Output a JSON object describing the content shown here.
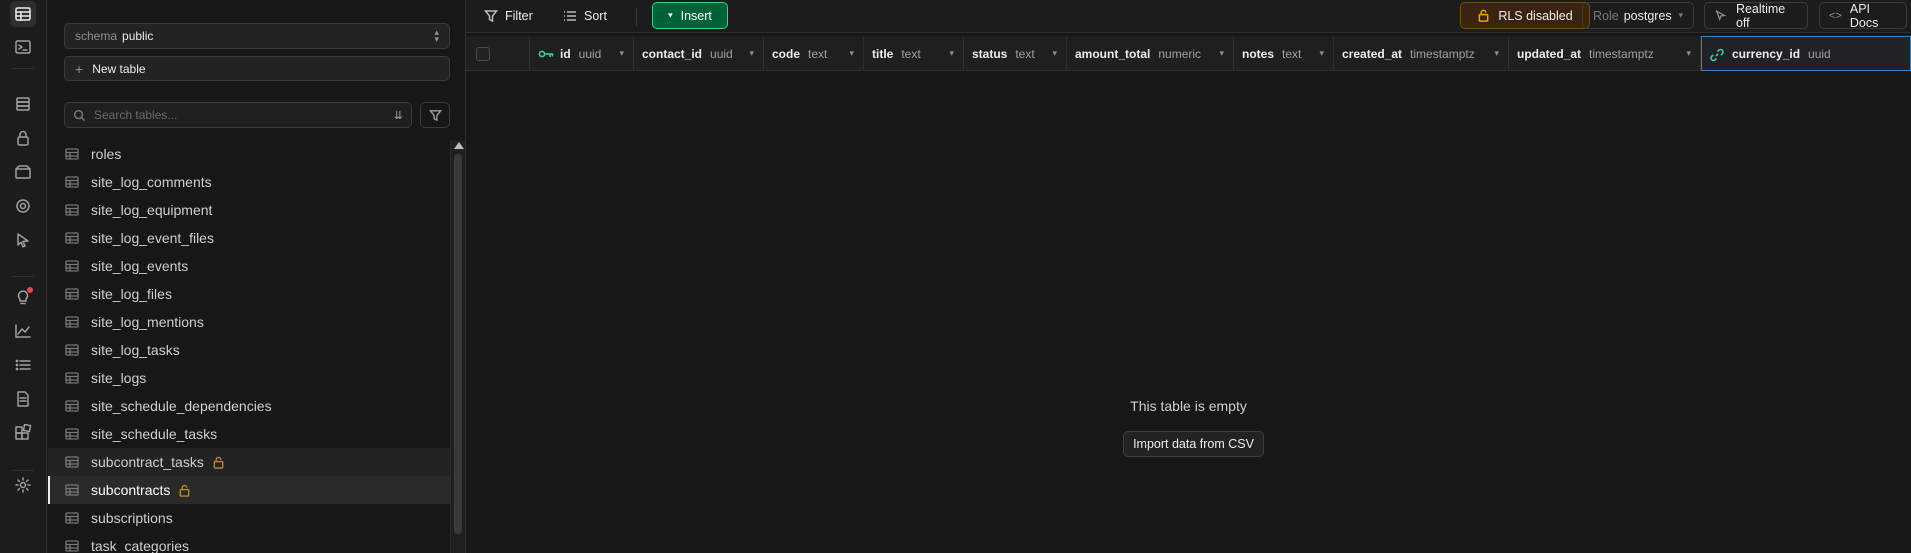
{
  "schema": {
    "label": "schema",
    "value": "public"
  },
  "sidebar": {
    "new_table_label": "New table",
    "search_placeholder": "Search tables...",
    "tables": [
      {
        "name": "roles",
        "locked": false
      },
      {
        "name": "site_log_comments",
        "locked": false
      },
      {
        "name": "site_log_equipment",
        "locked": false
      },
      {
        "name": "site_log_event_files",
        "locked": false
      },
      {
        "name": "site_log_events",
        "locked": false
      },
      {
        "name": "site_log_files",
        "locked": false
      },
      {
        "name": "site_log_mentions",
        "locked": false
      },
      {
        "name": "site_log_tasks",
        "locked": false
      },
      {
        "name": "site_logs",
        "locked": false
      },
      {
        "name": "site_schedule_dependencies",
        "locked": false
      },
      {
        "name": "site_schedule_tasks",
        "locked": false
      },
      {
        "name": "subcontract_tasks",
        "locked": true
      },
      {
        "name": "subcontracts",
        "locked": true
      },
      {
        "name": "subscriptions",
        "locked": false
      },
      {
        "name": "task_categories",
        "locked": false
      }
    ],
    "active_table": "subcontracts"
  },
  "toolbar": {
    "filter_label": "Filter",
    "sort_label": "Sort",
    "insert_label": "Insert",
    "rls_label": "RLS disabled",
    "role_label": "Role",
    "role_value": "postgres",
    "realtime_label": "Realtime off",
    "api_docs_label": "API Docs"
  },
  "columns": [
    {
      "name": "id",
      "type": "uuid",
      "primary_key": true
    },
    {
      "name": "contact_id",
      "type": "uuid"
    },
    {
      "name": "code",
      "type": "text"
    },
    {
      "name": "title",
      "type": "text"
    },
    {
      "name": "status",
      "type": "text"
    },
    {
      "name": "amount_total",
      "type": "numeric"
    },
    {
      "name": "notes",
      "type": "text"
    },
    {
      "name": "created_at",
      "type": "timestamptz"
    },
    {
      "name": "updated_at",
      "type": "timestamptz"
    },
    {
      "name": "currency_id",
      "type": "uuid",
      "foreign_key": true,
      "selected": true
    }
  ],
  "empty_state": {
    "title": "This table is empty",
    "import_label": "Import data from CSV"
  },
  "colors": {
    "accent_green": "#3ecf8e",
    "insert_bg": "#006239",
    "warning": "#f1a10d",
    "selection_border": "#3b82c4"
  }
}
